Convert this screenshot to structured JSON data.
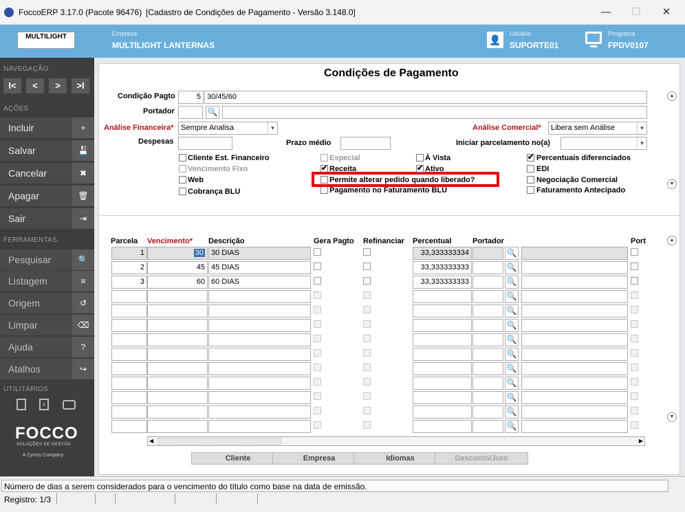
{
  "window": {
    "title_app": "FoccoERP 3.17.0 (Pacote 96476)",
    "title_form": "[Cadastro de Condições de Pagamento - Versão 3.148.0]",
    "minimize": "—",
    "maximize": "☐",
    "close": "✕"
  },
  "header": {
    "logo_text": "MULTILIGHT",
    "empresa_label": "Empresa",
    "empresa_value": "MULTILIGHT LANTERNAS",
    "usuario_label": "Usuário",
    "usuario_value": "SUPORTE01",
    "programa_label": "Programa",
    "programa_value": "FPDV0107"
  },
  "sidebar": {
    "nav_section": "NAVEGAÇÃO",
    "nav_buttons": [
      "I<",
      "<",
      ">",
      ">I"
    ],
    "acoes_section": "AÇÕES",
    "acoes": [
      {
        "label": "Incluir",
        "icon": "+"
      },
      {
        "label": "Salvar",
        "icon": "💾"
      },
      {
        "label": "Cancelar",
        "icon": "✖"
      },
      {
        "label": "Apagar",
        "icon": "🗑"
      },
      {
        "label": "Sair",
        "icon": "⇥"
      }
    ],
    "ferramentas_section": "FERRAMENTAS",
    "ferramentas": [
      {
        "label": "Pesquisar",
        "icon": "🔍"
      },
      {
        "label": "Listagem",
        "icon": "≡"
      },
      {
        "label": "Origem",
        "icon": "↺"
      },
      {
        "label": "Limpar",
        "icon": "⌫"
      },
      {
        "label": "Ajuda",
        "icon": "?"
      },
      {
        "label": "Atalhos",
        "icon": "↪"
      }
    ],
    "utilitarios_section": "UTILITÁRIOS",
    "brand": "FOCCO",
    "brand_sub": "SOLUÇÕES DE GESTÃO",
    "brand_company": "A Cyncly Company"
  },
  "form": {
    "title": "Condições de Pagamento",
    "condicao_label": "Condição Pagto",
    "condicao_code": "5",
    "condicao_desc": "30/45/60",
    "portador_label": "Portador",
    "portador_value": "",
    "analise_fin_label": "Análise Financeira",
    "analise_fin_value": "Sempre Analisa",
    "analise_com_label": "Análise Comercial",
    "analise_com_value": "Libera sem Análise",
    "despesas_label": "Despesas",
    "despesas_value": "",
    "prazo_label": "Prazo médio",
    "prazo_value": "",
    "iniciar_label": "Iniciar parcelamento no(a)",
    "iniciar_value": "",
    "checkboxes": {
      "cliente_est": "Cliente Est. Financeiro",
      "vencimento_fixo": "Vencimento Fixo",
      "web": "Web",
      "cobranca_blu": "Cobrança BLU",
      "especial": "Especial",
      "receita": "Receita",
      "permite_alterar": "Permite alterar pedido quando liberado?",
      "pagamento_fat": "Pagamento no Faturamento BLU",
      "a_vista": "À Vista",
      "ativo": "Ativo",
      "percentuais": "Percentuais diferenciados",
      "edi": "EDI",
      "negociacao": "Negociação Comercial",
      "faturamento_ant": "Faturamento Antecipado"
    },
    "checked_mark": "✔"
  },
  "grid": {
    "headers": {
      "parcela": "Parcela",
      "vencimento": "Vencimento",
      "descricao": "Descrição",
      "gera_pagto": "Gera Pagto",
      "refinanciar": "Refinanciar",
      "percentual": "Percentual",
      "portador": "Portador",
      "port": "Port"
    },
    "rows": [
      {
        "parcela": "1",
        "vencimento": "30",
        "descricao": "30 DIAS",
        "percentual": "33,333333334"
      },
      {
        "parcela": "2",
        "vencimento": "45",
        "descricao": "45 DIAS",
        "percentual": "33,333333333"
      },
      {
        "parcela": "3",
        "vencimento": "60",
        "descricao": "60 DIAS",
        "percentual": "33,333333333"
      }
    ]
  },
  "buttons": {
    "cliente": "Cliente",
    "empresa": "Empresa",
    "idiomas": "Idiomas",
    "desconto": "Desconto/Juro"
  },
  "statusbar": {
    "message": "Número de dias a serem considerados para o vencimento do título como base na data de emissão.",
    "registro": "Registro: 1/3"
  },
  "colors": {
    "header_bg": "#6aafdc",
    "sidebar_bg": "#3d3d3d",
    "required_red": "#b0141a",
    "highlight_box": "#e8000c"
  }
}
